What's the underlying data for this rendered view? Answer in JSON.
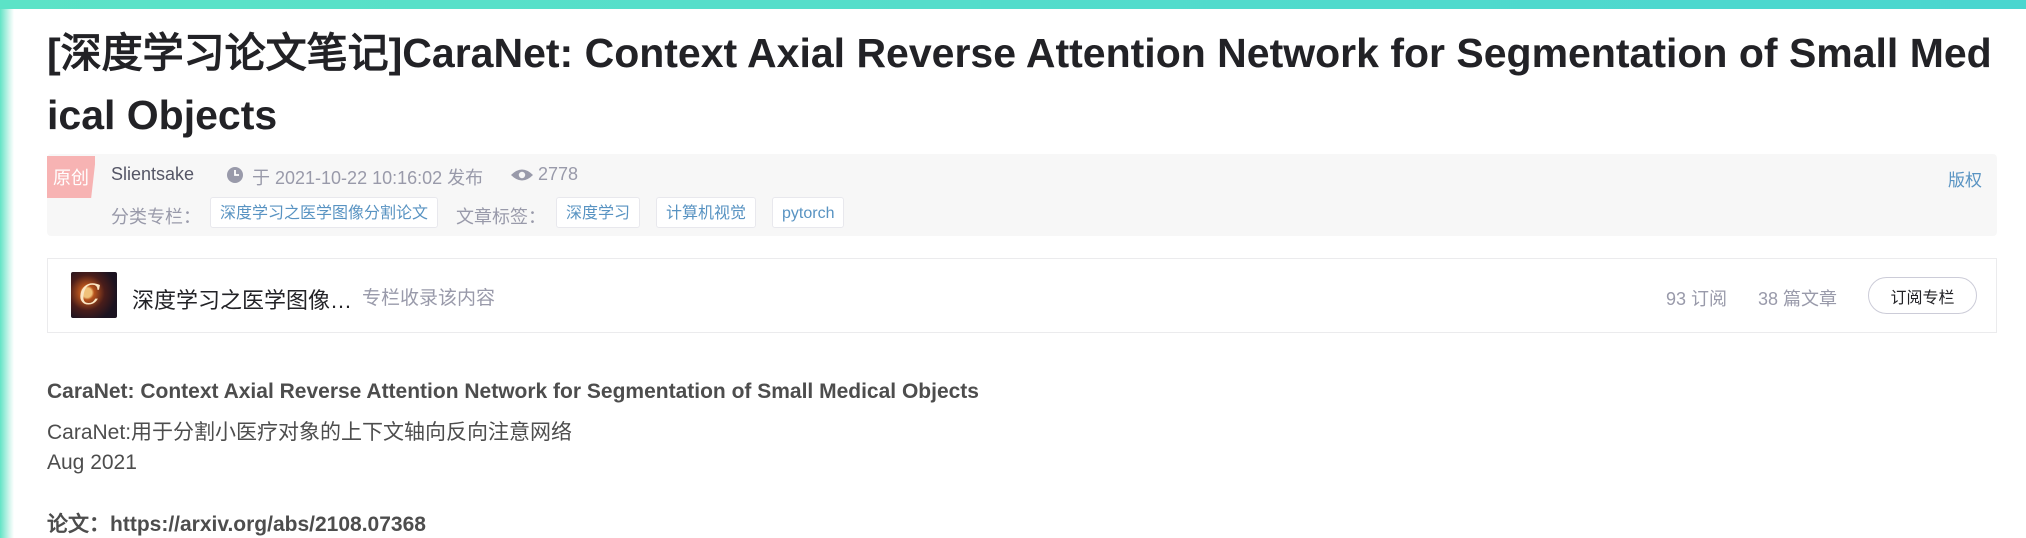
{
  "article": {
    "title": "[深度学习论文笔记]CaraNet: Context Axial Reverse Attention Network for Segmentation of Small Medical Objects",
    "badge": "原创",
    "author": "Slientsake",
    "published": "于 2021-10-22 10:16:02 发布",
    "views": "2778",
    "copyright": "版权",
    "category_label": "分类专栏：",
    "category": "深度学习之医学图像分割论文",
    "tags_label": "文章标签：",
    "tags": [
      "深度学习",
      "计算机视觉",
      "pytorch"
    ]
  },
  "column": {
    "name": "深度学习之医学图像…",
    "note": "专栏收录该内容",
    "subscribers": "93 订阅",
    "articles": "38 篇文章",
    "subscribe_button": "订阅专栏"
  },
  "content": {
    "paper_title": "CaraNet: Context Axial Reverse Attention Network for Segmentation of Small Medical Objects",
    "paper_title_zh": "CaraNet:用于分割小医疗对象的上下文轴向反向注意网络",
    "date": "Aug 2021",
    "link_text": "论文：https://arxiv.org/abs/2108.07368"
  },
  "colors": {
    "accent_bar": "#4ad6cf",
    "link_blue": "#5893c2",
    "badge_pink": "#f7b3b3"
  }
}
